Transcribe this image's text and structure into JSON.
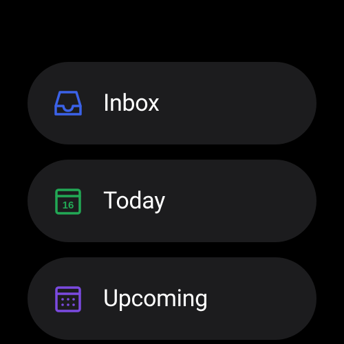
{
  "nav": {
    "items": [
      {
        "label": "Inbox",
        "icon": "inbox-icon",
        "iconColor": "#3b62e8"
      },
      {
        "label": "Today",
        "icon": "calendar-day-icon",
        "iconColor": "#22a855",
        "iconBadge": "16"
      },
      {
        "label": "Upcoming",
        "icon": "calendar-upcoming-icon",
        "iconColor": "#7b4ae0"
      }
    ]
  }
}
